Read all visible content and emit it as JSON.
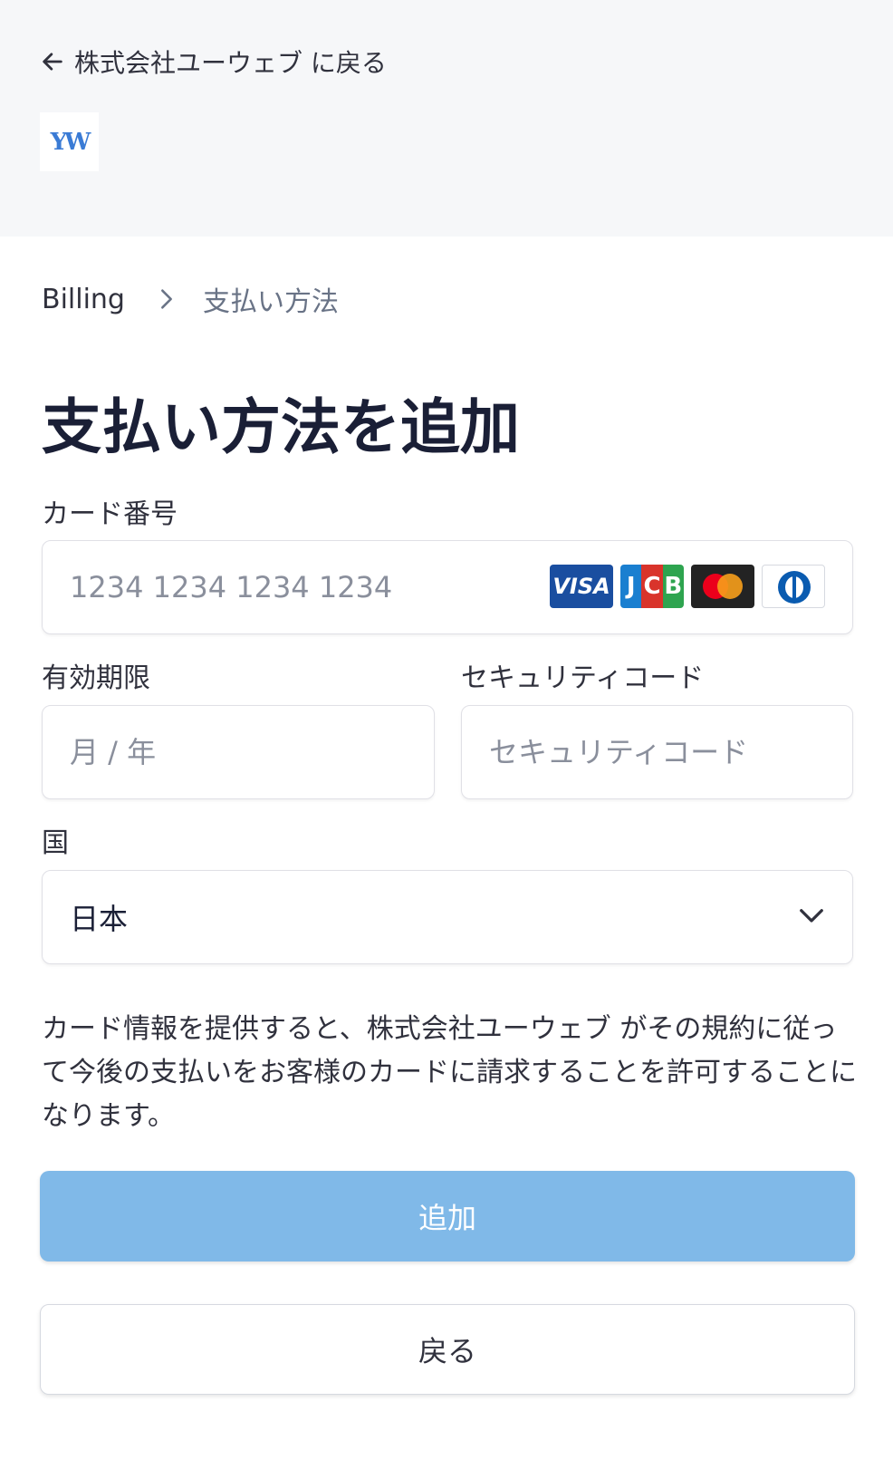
{
  "header": {
    "back_label": "株式会社ユーウェブ に戻る",
    "back_icon": "arrow-left-icon",
    "logo_text": "YW"
  },
  "breadcrumb": {
    "root": "Billing",
    "current": "支払い方法"
  },
  "page_title": "支払い方法を追加",
  "form": {
    "card_number": {
      "label": "カード番号",
      "placeholder": "1234 1234 1234 1234",
      "value": "",
      "brands": [
        "VISA",
        "JCB",
        "Mastercard",
        "Diners Club"
      ]
    },
    "expiry": {
      "label": "有効期限",
      "placeholder": "月 / 年",
      "value": ""
    },
    "cvc": {
      "label": "セキュリティコード",
      "placeholder": "セキュリティコード",
      "value": ""
    },
    "country": {
      "label": "国",
      "value": "日本"
    }
  },
  "disclaimer": "カード情報を提供すると、株式会社ユーウェブ がその規約に従って今後の支払いをお客様のカードに請求することを許可することになります。",
  "buttons": {
    "add": "追加",
    "back": "戻る"
  },
  "colors": {
    "header_bg": "#f6f7f9",
    "primary_button": "#80b9e8",
    "text_primary": "#1a1f36",
    "text_muted": "#697386"
  }
}
